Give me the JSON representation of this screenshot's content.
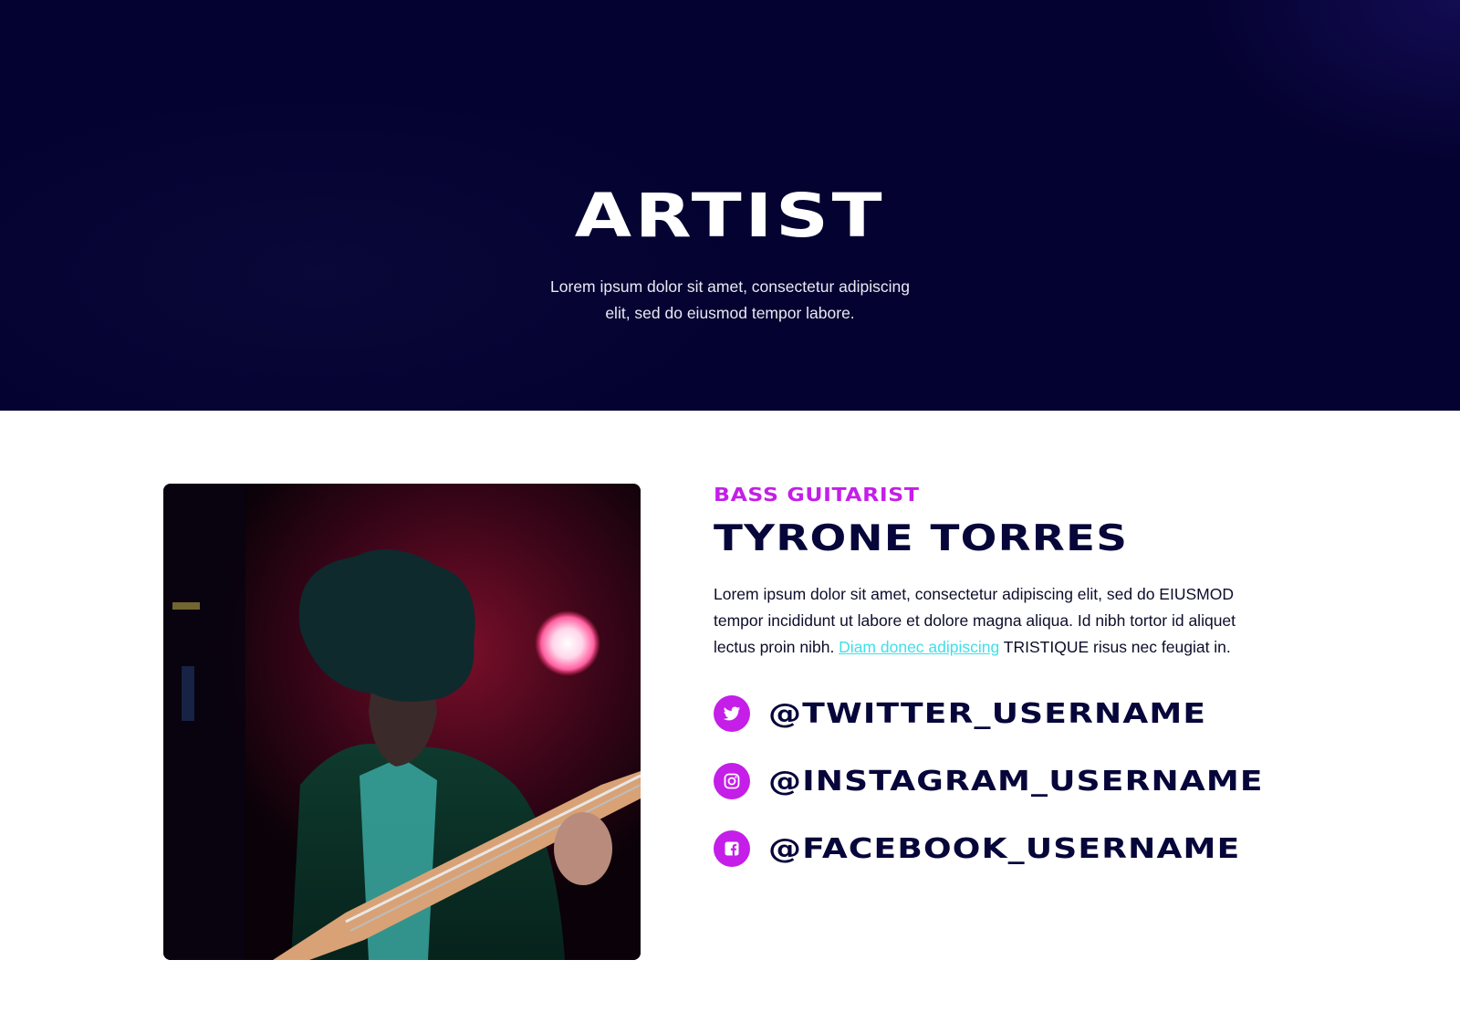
{
  "hero": {
    "title": "ARTIST",
    "subtitle": "Lorem ipsum dolor sit amet, consectetur adipiscing elit, sed do eiusmod tempor labore."
  },
  "profile": {
    "photo_alt": "Bass guitarist playing on stage under red light",
    "role": "BASS GUITARIST",
    "name": "TYRONE TORRES",
    "bio": {
      "text_before": "Lorem ipsum dolor sit amet, consectetur adipiscing elit, sed do EIUSMOD tempor incididunt ut labore et dolore magna aliqua. Id nibh tortor id aliquet lectus proin nibh. ",
      "link_text": "Diam donec adipiscing",
      "text_after": " TRISTIQUE risus nec feugiat in."
    },
    "socials": [
      {
        "icon": "twitter-icon",
        "handle": "@TWITTER_USERNAME"
      },
      {
        "icon": "instagram-icon",
        "handle": "@INSTAGRAM_USERNAME"
      },
      {
        "icon": "facebook-icon",
        "handle": "@FACEBOOK_USERNAME"
      }
    ]
  },
  "colors": {
    "hero_background": "#040230",
    "accent": "#c41ee8",
    "heading": "#07063a",
    "link": "#3fe0e8"
  }
}
